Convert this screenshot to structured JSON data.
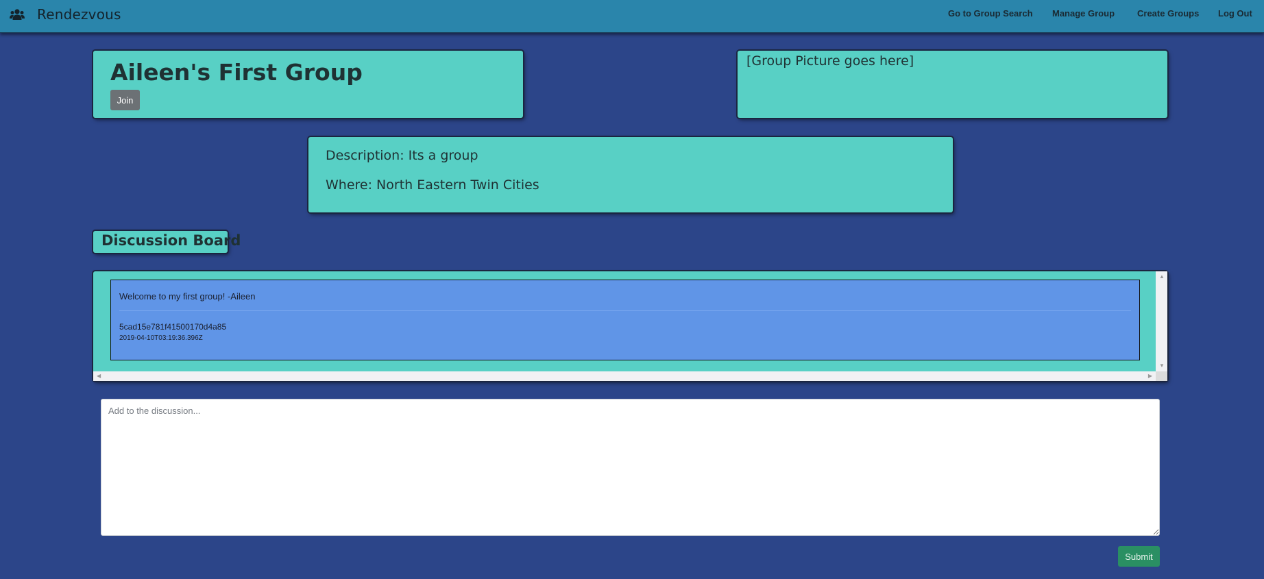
{
  "navbar": {
    "brand": "Rendezvous",
    "brand_icon": "users-icon",
    "links": [
      "Go to Group Search",
      "Manage Group",
      "Create Groups",
      "Log Out"
    ]
  },
  "group": {
    "title": "Aileen's First Group",
    "join_label": "Join",
    "picture_placeholder": "[Group Picture goes here]",
    "description": "Description: Its a group",
    "where": "Where: North Eastern Twin Cities"
  },
  "discussion": {
    "title": "Discussion Board",
    "messages": [
      {
        "text": "Welcome to my first group! -Aileen",
        "author_id": "5cad15e781f41500170d4a85",
        "timestamp": "2019-04-10T03:19:36.396Z"
      }
    ],
    "input_placeholder": "Add to the discussion...",
    "submit_label": "Submit"
  },
  "colors": {
    "page_background": "#2c4589",
    "navbar": "#2a85ab",
    "panel": "#58d0c5",
    "message_background": "#6095e7",
    "submit_button": "#2a8f63",
    "join_button": "#6c7175"
  }
}
